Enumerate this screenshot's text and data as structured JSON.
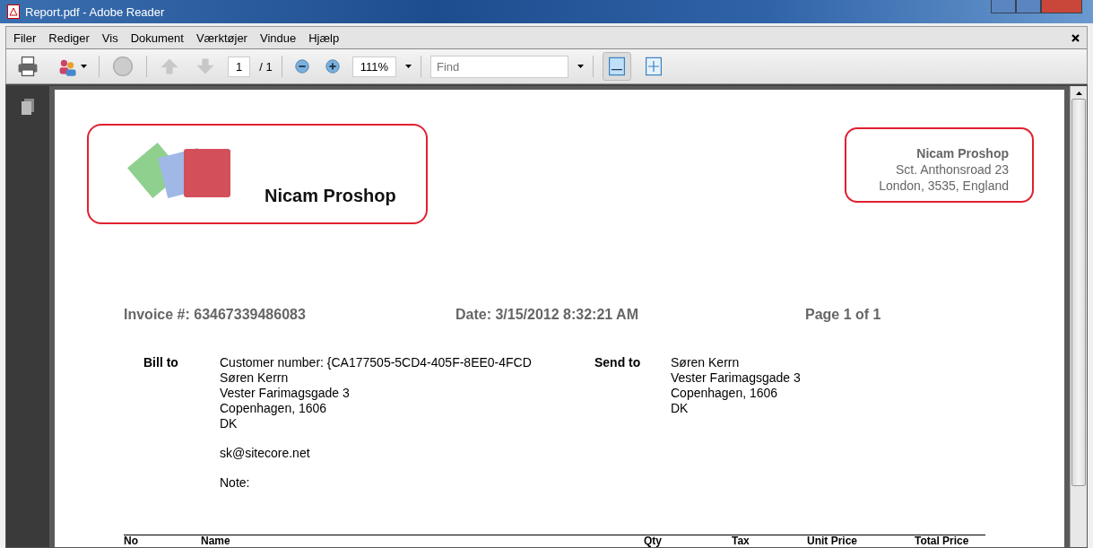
{
  "window": {
    "title": "Report.pdf - Adobe Reader"
  },
  "menu": [
    {
      "label": "Filer"
    },
    {
      "label": "Rediger"
    },
    {
      "label": "Vis"
    },
    {
      "label": "Dokument"
    },
    {
      "label": "Værktøjer"
    },
    {
      "label": "Vindue"
    },
    {
      "label": "Hjælp"
    }
  ],
  "toolbar": {
    "page": "1",
    "page_total": "/ 1",
    "zoom": "111%",
    "find": {
      "placeholder": "Find"
    }
  },
  "header": {
    "company": "Nicam Proshop",
    "address": [
      "Nicam Proshop",
      "Sct. Anthonsroad 23",
      "London, 3535, England"
    ]
  },
  "invoice": {
    "number": "Invoice #: 63467339486083",
    "date": "Date: 3/15/2012 8:32:21 AM",
    "page": "Page 1 of 1"
  },
  "bill_to": {
    "label": "Bill to",
    "lines": [
      "Customer number: {CA177505-5CD4-405F-8EE0-4FCD",
      "Søren Kerrn",
      "Vester Farimagsgade 3",
      "Copenhagen, 1606",
      "DK"
    ],
    "email": "sk@sitecore.net",
    "note": "Note:"
  },
  "send_to": {
    "label": "Send to",
    "lines": [
      "Søren Kerrn",
      "Vester Farimagsgade 3",
      "Copenhagen, 1606",
      "DK"
    ]
  },
  "table": {
    "columns": [
      "No",
      "Name",
      "Qty",
      "Tax",
      "Unit Price",
      "Total Price"
    ]
  }
}
